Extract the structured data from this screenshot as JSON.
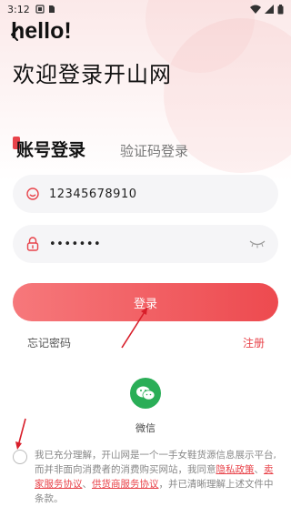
{
  "status_bar": {
    "time": "3:12"
  },
  "header": {
    "greeting": "hello!",
    "welcome": "欢迎登录开山网"
  },
  "tabs": [
    {
      "label": "账号登录",
      "active": true
    },
    {
      "label": "验证码登录",
      "active": false
    }
  ],
  "form": {
    "phone_value": "12345678910",
    "password_value": "•••••••"
  },
  "actions": {
    "login_label": "登录",
    "forgot_label": "忘记密码",
    "register_label": "注册"
  },
  "social": {
    "wechat_label": "微信"
  },
  "agreement": {
    "text_1": "我已充分理解，开山网是一个一手女鞋货源信息展示平台,而并非面向消费者的消费购买网站，我同意",
    "link_privacy": "隐私政策",
    "sep_1": "、",
    "link_seller": "卖家服务协议",
    "sep_2": "、",
    "link_supplier": "供货商服务协议",
    "text_2": "，并已清晰理解上述文件中条款。"
  },
  "colors": {
    "accent": "#e8434a",
    "button_start": "#f6787b",
    "button_end": "#ed4a4f",
    "wechat": "#2aae57",
    "field_bg": "#f5f5f7"
  }
}
